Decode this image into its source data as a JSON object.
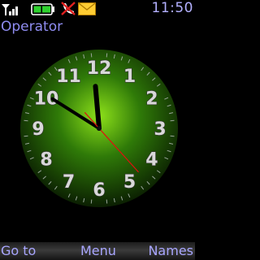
{
  "status_bar": {
    "time": "11:50",
    "icons": [
      "signal-icon",
      "battery-icon",
      "call-missed-icon",
      "message-icon"
    ]
  },
  "idle_screen": {
    "operator": "Operator"
  },
  "clock": {
    "numerals": [
      "12",
      "1",
      "2",
      "3",
      "4",
      "5",
      "6",
      "7",
      "8",
      "9",
      "10",
      "11"
    ],
    "time": {
      "hours": 11,
      "minutes": 50,
      "seconds": 23
    },
    "colors": {
      "face_center": "#8de01a",
      "face_mid": "#2f7a08",
      "face_edge": "#0b1f02",
      "numeral": "#d8d8d8",
      "hand": "#000000",
      "second_hand": "#e01010"
    }
  },
  "softkeys": {
    "left": "Go to",
    "center": "Menu",
    "right": "Names"
  }
}
